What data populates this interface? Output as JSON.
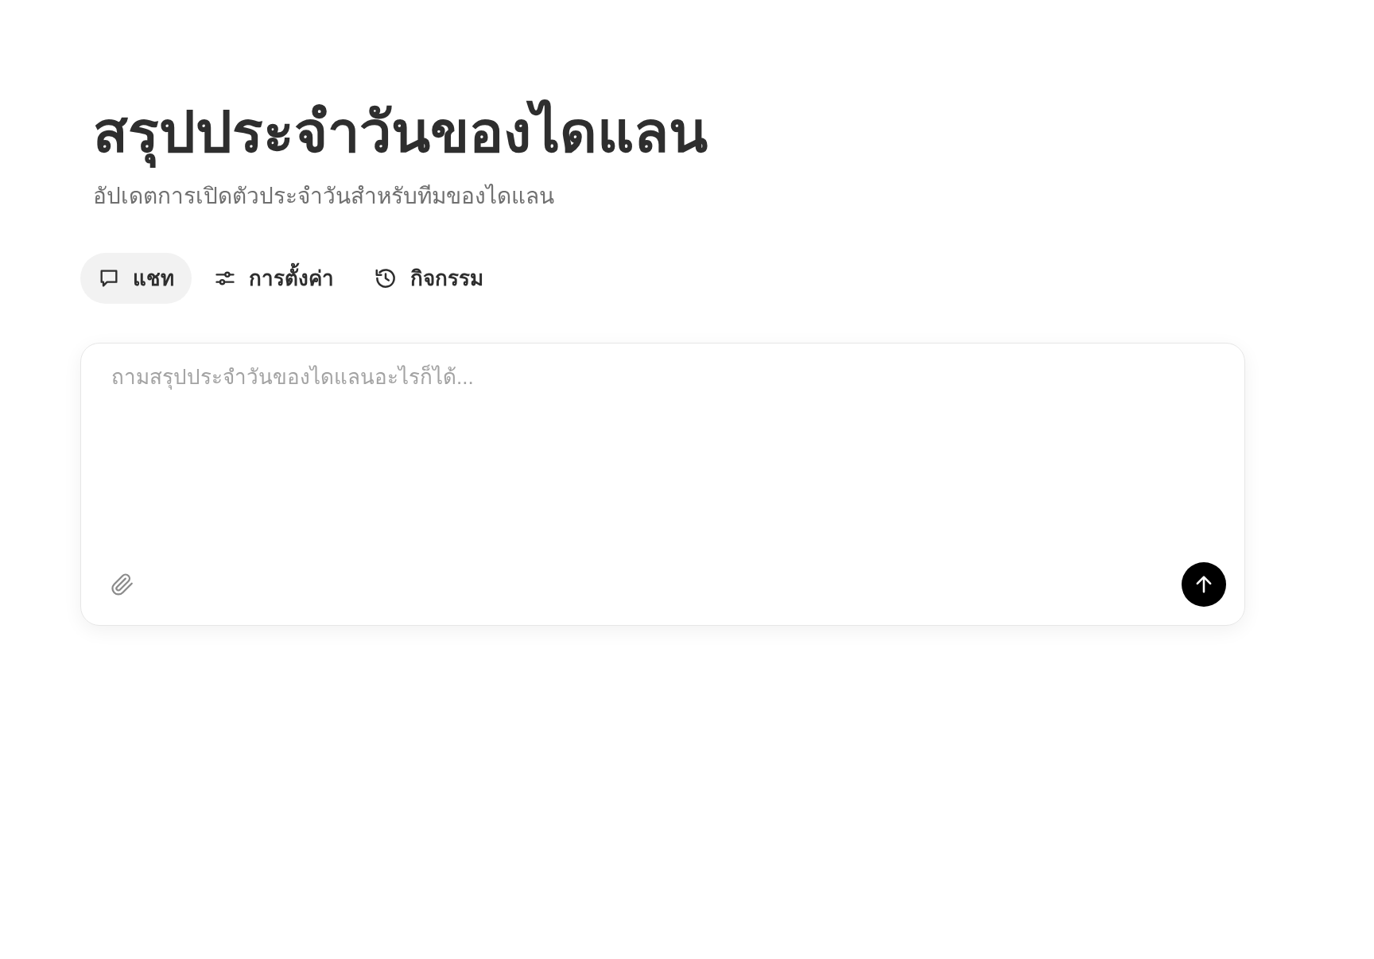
{
  "header": {
    "title": "สรุปประจำวันของไดแลน",
    "subtitle": "อัปเดตการเปิดตัวประจำวันสำหรับทีมของไดแลน"
  },
  "tabs": [
    {
      "kind": "chat",
      "label": "แชท",
      "selected": true
    },
    {
      "kind": "settings",
      "label": "การตั้งค่า",
      "selected": false
    },
    {
      "kind": "activity",
      "label": "กิจกรรม",
      "selected": false
    }
  ],
  "composer": {
    "placeholder": "ถามสรุปประจำวันของไดแลนอะไรก็ได้..."
  }
}
